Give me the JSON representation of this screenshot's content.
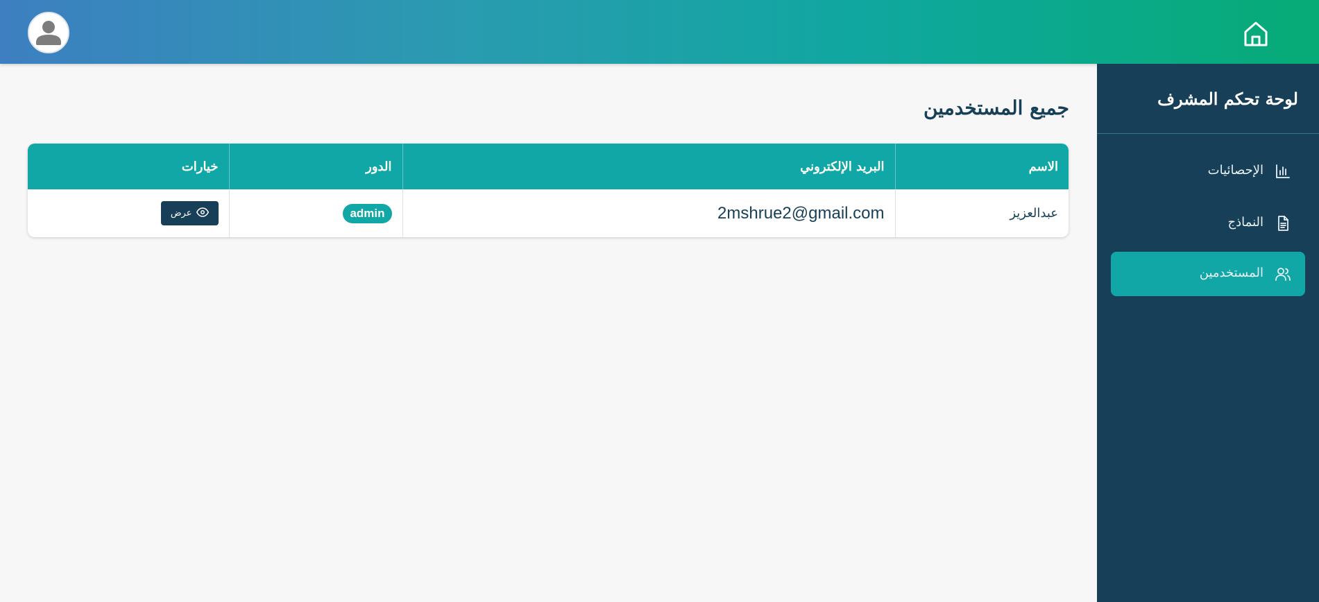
{
  "sidebar": {
    "title": "لوحة تحكم المشرف",
    "items": [
      {
        "label": "الإحصائيات",
        "icon": "bar-chart-icon"
      },
      {
        "label": "النماذج",
        "icon": "document-icon"
      },
      {
        "label": "المستخدمين",
        "icon": "users-icon",
        "active": true
      }
    ]
  },
  "main": {
    "title": "جميع المستخدمين",
    "table": {
      "headers": [
        "الاسم",
        "البريد الإلكتروني",
        "الدور",
        "خيارات"
      ],
      "rows": [
        {
          "name": "عبدالعزيز",
          "email": "2mshrue2@gmail.com",
          "role": "admin",
          "action_label": "عرض"
        }
      ]
    }
  },
  "colors": {
    "sidebar_bg": "#173f57",
    "accent": "#10a7a6",
    "header_gradient_start": "#3d7fc1",
    "header_gradient_end": "#06ab76"
  }
}
